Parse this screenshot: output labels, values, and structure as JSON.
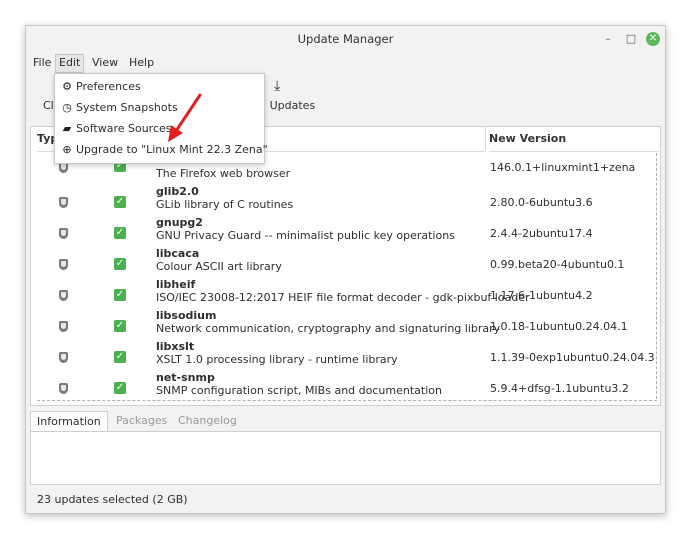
{
  "window": {
    "title": "Update Manager",
    "minimize_glyph": "–",
    "maximize_glyph": "□",
    "close_glyph": "✕"
  },
  "menubar": {
    "file": "File",
    "edit": "Edit",
    "view": "View",
    "help": "Help"
  },
  "toolbar": {
    "clear_partial": "Cl",
    "install_partial": "ll Updates",
    "install_icon": "download-icon"
  },
  "columns": {
    "type": "Typ",
    "new_version": "New Version"
  },
  "packages": [
    {
      "name": "",
      "desc": "The Firefox web browser",
      "version": "146.0.1+linuxmint1+zena"
    },
    {
      "name": "glib2.0",
      "desc": "GLib library of C routines",
      "version": "2.80.0-6ubuntu3.6"
    },
    {
      "name": "gnupg2",
      "desc": "GNU Privacy Guard -- minimalist public key operations",
      "version": "2.4.4-2ubuntu17.4"
    },
    {
      "name": "libcaca",
      "desc": "Colour ASCII art library",
      "version": "0.99.beta20-4ubuntu0.1"
    },
    {
      "name": "libheif",
      "desc": "ISO/IEC 23008-12:2017 HEIF file format decoder - gdk-pixbuf loader",
      "version": "1.17.6-1ubuntu4.2"
    },
    {
      "name": "libsodium",
      "desc": "Network communication, cryptography and signaturing library",
      "version": "1.0.18-1ubuntu0.24.04.1"
    },
    {
      "name": "libxslt",
      "desc": "XSLT 1.0 processing library - runtime library",
      "version": "1.1.39-0exp1ubuntu0.24.04.3"
    },
    {
      "name": "net-snmp",
      "desc": "SNMP configuration script, MIBs and documentation",
      "version": "5.9.4+dfsg-1.1ubuntu3.2"
    }
  ],
  "tabs": {
    "information": "Information",
    "packages": "Packages",
    "changelog": "Changelog"
  },
  "status": {
    "text": "23 updates selected (2 GB)"
  },
  "edit_menu": {
    "items": [
      {
        "label": "Preferences",
        "icon": "preferences-icon"
      },
      {
        "label": "System Snapshots",
        "icon": "snapshot-clock-icon"
      },
      {
        "label": "Software Sources",
        "icon": "package-icon"
      },
      {
        "label": "Upgrade to \"Linux Mint 22.3 Zena\"",
        "icon": "upgrade-arrow-icon"
      }
    ]
  },
  "colors": {
    "accent_green": "#5cb85c",
    "checkbox_green": "#4caf50",
    "annotation_red": "#e02020"
  }
}
